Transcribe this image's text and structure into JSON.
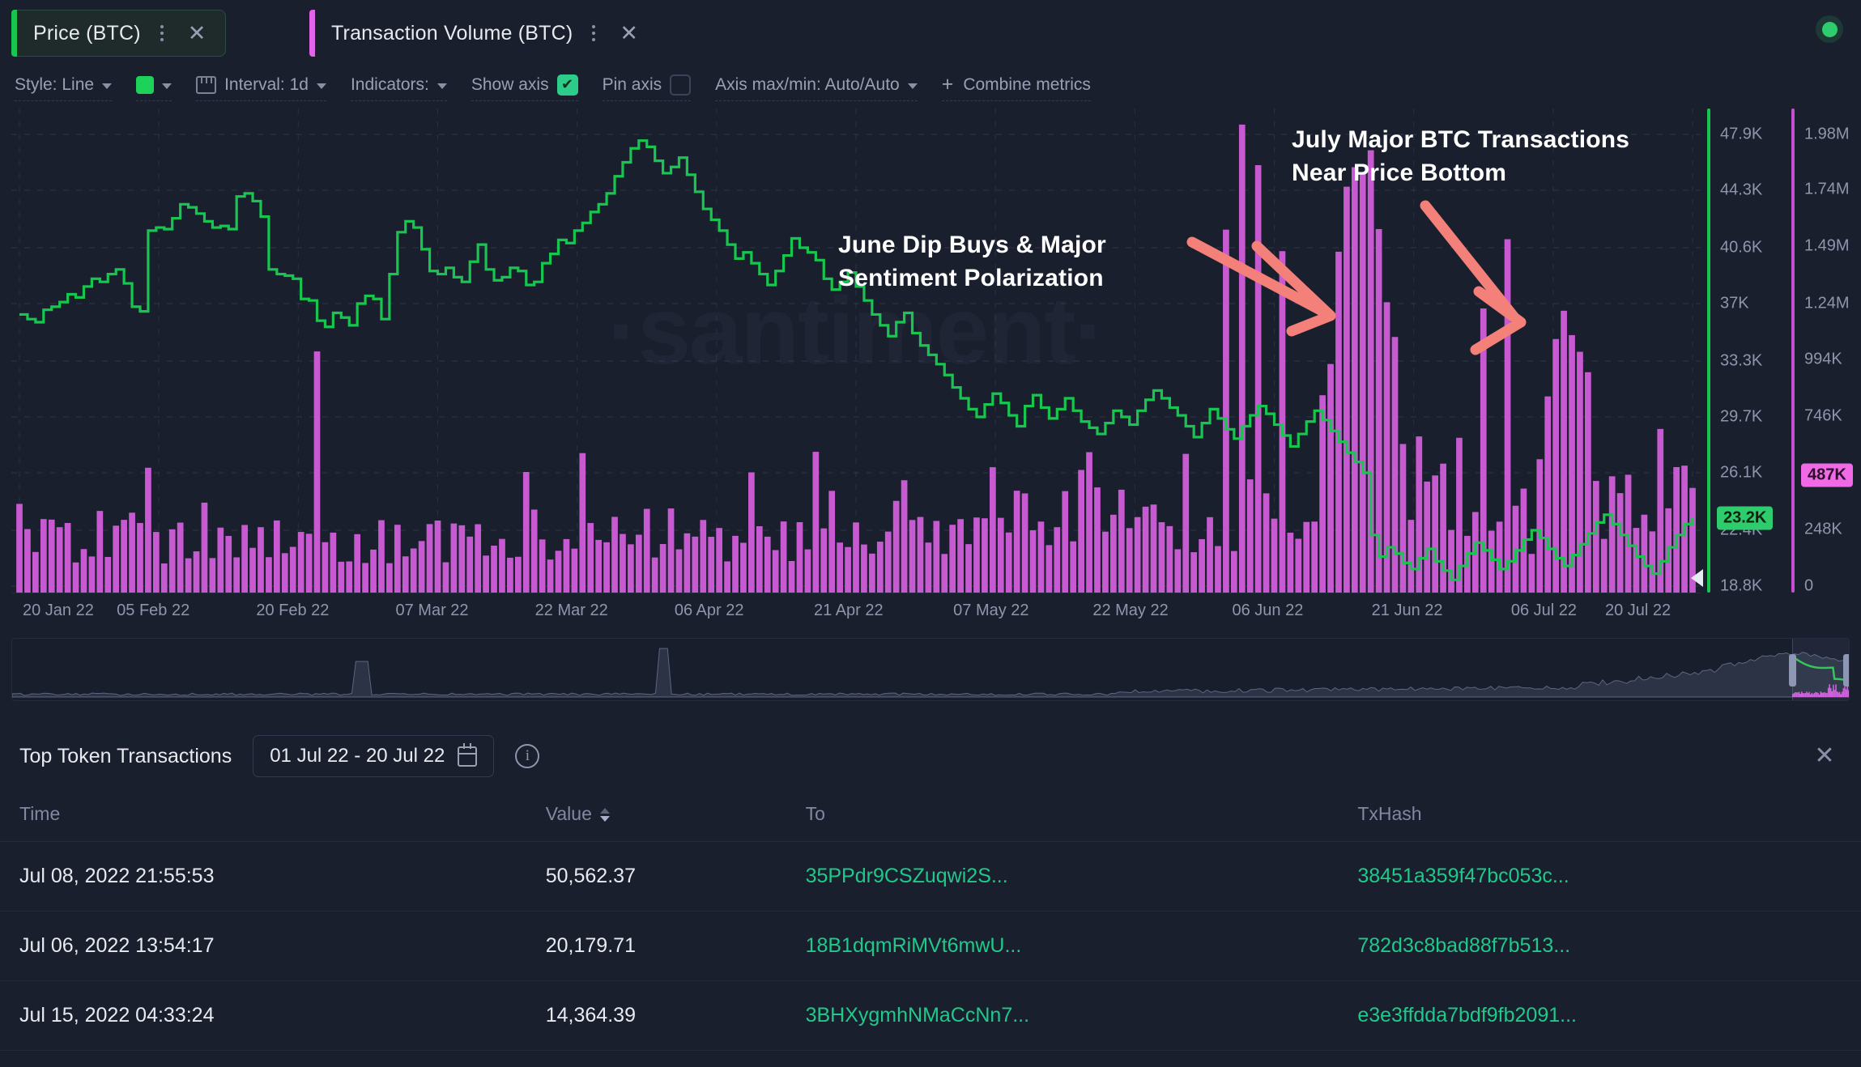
{
  "tabs": [
    {
      "label": "Price (BTC)",
      "accent": "#18c64f",
      "active": true
    },
    {
      "label": "Transaction Volume (BTC)",
      "accent": "#e264e8",
      "active": false
    }
  ],
  "status": {
    "name": "live-indicator",
    "color": "#2ecc6d"
  },
  "toolbar": {
    "style_label": "Style: Line",
    "color_swatch": "#1dd159",
    "interval_label": "Interval: 1d",
    "indicators_label": "Indicators:",
    "show_axis_label": "Show axis",
    "show_axis_checked": true,
    "pin_axis_label": "Pin axis",
    "pin_axis_checked": false,
    "axis_minmax_label": "Axis max/min: Auto/Auto",
    "combine_metrics_label": "Combine metrics",
    "plus_glyph": "+"
  },
  "watermark": "·santiment·",
  "annotations": [
    {
      "id": "june",
      "text": "June Dip Buys & Major\nSentiment Polarization",
      "color": "#ffffff"
    },
    {
      "id": "july",
      "text": "July Major BTC Transactions\nNear Price Bottom",
      "color": "#ffffff"
    }
  ],
  "arrow_color": "#f4807a",
  "chart_data": {
    "type": "line",
    "title": "",
    "xlabel": "",
    "ylabel": "Price (BTC)",
    "grid": true,
    "legend": "tabs",
    "x_ticks": [
      "20 Jan 22",
      "05 Feb 22",
      "20 Feb 22",
      "07 Mar 22",
      "22 Mar 22",
      "06 Apr 22",
      "21 Apr 22",
      "07 May 22",
      "22 May 22",
      "06 Jun 22",
      "21 Jun 22",
      "06 Jul 22",
      "20 Jul 22"
    ],
    "y_left": {
      "name": "Price (BTC)",
      "color": "#18c64f",
      "ticks": [
        "47.9K",
        "44.3K",
        "40.6K",
        "37K",
        "33.3K",
        "29.7K",
        "26.1K",
        "22.4K",
        "18.8K"
      ],
      "tick_values": [
        47900,
        44300,
        40600,
        37000,
        33300,
        29700,
        26100,
        22400,
        18800
      ],
      "range": [
        18800,
        47900
      ],
      "current_badge": "23.2K",
      "current_value": 23200
    },
    "y_right": {
      "name": "Transaction Volume (BTC)",
      "color": "#c44fd1",
      "ticks": [
        "1.98M",
        "1.74M",
        "1.49M",
        "1.24M",
        "994K",
        "746K",
        "487K",
        "248K",
        "0"
      ],
      "tick_values": [
        1980000,
        1740000,
        1490000,
        1240000,
        994000,
        746000,
        487000,
        248000,
        0
      ],
      "range": [
        0,
        1980000
      ],
      "current_badge": "487K",
      "current_value": 487000
    },
    "series": [
      {
        "name": "Price (BTC)",
        "type": "line",
        "color": "#18c64f",
        "axis": "left",
        "values": [
          36300,
          36000,
          35800,
          36600,
          36800,
          37100,
          37600,
          37400,
          38100,
          38600,
          38400,
          38900,
          39200,
          38300,
          36800,
          36500,
          41700,
          41900,
          41800,
          42500,
          43400,
          43200,
          42800,
          42300,
          41900,
          42000,
          41800,
          43900,
          44100,
          43600,
          42600,
          39200,
          38900,
          38800,
          38600,
          37300,
          37200,
          35900,
          35500,
          36400,
          36100,
          35600,
          37000,
          37500,
          37300,
          36000,
          38900,
          41600,
          42300,
          41900,
          40500,
          39100,
          38900,
          39300,
          38700,
          38400,
          39700,
          40800,
          39200,
          38500,
          38700,
          39300,
          39100,
          38200,
          38400,
          39600,
          40200,
          41100,
          40900,
          41700,
          42200,
          42900,
          43400,
          44100,
          45200,
          46100,
          47000,
          47500,
          47100,
          46200,
          45400,
          45800,
          46400,
          45300,
          44200,
          43100,
          42400,
          41700,
          40800,
          39900,
          40300,
          39600,
          38900,
          38200,
          39100,
          40100,
          41200,
          40600,
          40300,
          39800,
          38600,
          37900,
          38400,
          39000,
          38100,
          37200,
          36300,
          35600,
          34900,
          35800,
          36400,
          35100,
          34300,
          33700,
          33100,
          32400,
          31600,
          30900,
          30200,
          29700,
          30500,
          31200,
          30600,
          29800,
          29100,
          30400,
          31100,
          30300,
          29600,
          30200,
          30900,
          30100,
          29400,
          29000,
          28600,
          29300,
          30100,
          29700,
          29200,
          30100,
          30800,
          31400,
          30900,
          30300,
          29800,
          29100,
          28400,
          29300,
          30200,
          29600,
          28900,
          28300,
          29100,
          29800,
          30400,
          29900,
          29200,
          28500,
          27800,
          28600,
          29400,
          30100,
          29500,
          28800,
          28100,
          27400,
          26800,
          26100,
          22100,
          20700,
          21300,
          20900,
          20300,
          19900,
          20600,
          21200,
          20400,
          19800,
          19200,
          20100,
          20900,
          21600,
          21100,
          20500,
          19900,
          20400,
          21100,
          21800,
          22400,
          21900,
          21200,
          20600,
          20100,
          20800,
          21500,
          22200,
          22900,
          23400,
          22800,
          22100,
          21400,
          20700,
          20100,
          19600,
          20400,
          21300,
          22100,
          22800,
          23200
        ]
      },
      {
        "name": "Transaction Volume (BTC)",
        "type": "bar",
        "color": "#d65fe0",
        "axis": "right",
        "description": "Daily BTC transaction volume bars; baseline noise 100K-350K with sporadic spikes; massive cluster mid-June reaching ~1.98M, secondary cluster mid-July reaching ~1.5M"
      }
    ]
  },
  "minimap": {
    "window_label": "visible-range"
  },
  "panel": {
    "title": "Top Token Transactions",
    "date_range": "01 Jul 22 - 20 Jul 22",
    "info_glyph": "i",
    "close_glyph": "✕",
    "columns": [
      {
        "key": "time",
        "label": "Time",
        "sortable": false
      },
      {
        "key": "value",
        "label": "Value",
        "sortable": true
      },
      {
        "key": "to",
        "label": "To",
        "sortable": false
      },
      {
        "key": "hash",
        "label": "TxHash",
        "sortable": false
      }
    ],
    "rows": [
      {
        "time": "Jul 08, 2022 21:55:53",
        "value": "50,562.37",
        "to": "35PPdr9CSZuqwi2S...",
        "hash": "38451a359f47bc053c..."
      },
      {
        "time": "Jul 06, 2022 13:54:17",
        "value": "20,179.71",
        "to": "18B1dqmRiMVt6mwU...",
        "hash": "782d3c8bad88f7b513..."
      },
      {
        "time": "Jul 15, 2022 04:33:24",
        "value": "14,364.39",
        "to": "3BHXygmhNMaCcNn7...",
        "hash": "e3e3ffdda7bdf9fb2091..."
      }
    ]
  }
}
